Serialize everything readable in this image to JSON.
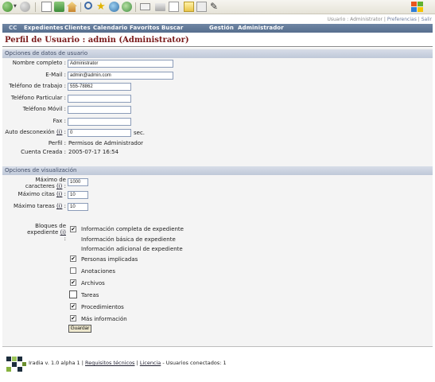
{
  "colors": {
    "nav_bar": "#6178a0",
    "title": "#7a1a1a",
    "section_header": "#c8d0de",
    "panel": "#f4f4f4",
    "button": "#efe9cf"
  },
  "toolbar": {
    "icons": [
      "back-icon",
      "forward-icon",
      "print-icon",
      "refresh-icon",
      "home-icon",
      "search-icon",
      "favorites-icon",
      "media-icon",
      "history-icon",
      "mail-icon",
      "print-icon",
      "edit-icon",
      "folder-icon",
      "messenger-icon",
      "research-icon",
      "windows-logo-icon"
    ]
  },
  "header": {
    "user_text": "Usuario : Administrator",
    "separator": "|",
    "preferences_link": "Preferencias",
    "exit_link": "Salir"
  },
  "nav": {
    "cc": "CC",
    "items": [
      "Expedientes",
      "Clientes",
      "Calendario",
      "Favoritos",
      "Buscar",
      "Gestión",
      "Administrador"
    ]
  },
  "page_title": "Perfil de Usuario : admin (Administrator)",
  "section1": {
    "header": "Opciones de datos de usuario",
    "fields": {
      "full_name": {
        "label": "Nombre completo :",
        "value": "Administrator"
      },
      "email": {
        "label": "E-Mail :",
        "value": "admin@admin.com"
      },
      "work_phone": {
        "label": "Teléfono de trabajo :",
        "value": "555-78862"
      },
      "home_phone": {
        "label": "Teléfono Particular :",
        "value": ""
      },
      "mobile_phone": {
        "label": "Teléfono Móvil :",
        "value": ""
      },
      "fax": {
        "label": "Fax :",
        "value": ""
      },
      "auto_logout": {
        "label": "Auto desconexión",
        "help": "(i)",
        "colon": ":",
        "value": "0",
        "unit": "sec."
      },
      "profile": {
        "label": "Perfil :",
        "value": "Permisos de Administrador"
      },
      "account_created": {
        "label": "Cuenta Creada :",
        "value": "2005-07-17 16:54"
      }
    }
  },
  "section2": {
    "header": "Opciones de visualización",
    "max_chars": {
      "label": "Máximo de caracteres",
      "help": "(i)",
      "colon": ":",
      "value": "1000"
    },
    "max_appointments": {
      "label": "Máximo citas",
      "help": "(i)",
      "colon": ":",
      "value": "10"
    },
    "max_tasks": {
      "label": "Máximo tareas",
      "help": "(i)",
      "colon": ":",
      "value": "10"
    },
    "blocks_label": "Bloques de expediente",
    "blocks_help": "(i)",
    "blocks_colon": ":",
    "blocks": [
      {
        "label": "Información completa de expediente",
        "checked": true,
        "check_mark": "✔"
      },
      {
        "label": "Información básica de expediente"
      },
      {
        "label": "Información adicional de expediente"
      },
      {
        "label": "Personas implicadas",
        "checked": true,
        "check_mark": "✔"
      },
      {
        "label": "Anotaciones",
        "checked": false,
        "check_mark": ""
      },
      {
        "label": "Archivos",
        "checked": true,
        "check_mark": "✔"
      },
      {
        "label": "Tareas",
        "checked": false,
        "check_mark": ""
      },
      {
        "label": "Procedimientos",
        "checked": true,
        "check_mark": "✔"
      },
      {
        "label": "Más información",
        "checked": true,
        "check_mark": "✔"
      }
    ],
    "save_label": "Guardar"
  },
  "footer": {
    "app_text": "Iradia v. 1.0 alpha 1",
    "sep1": "|",
    "link1": "Requisitos técnicos",
    "sep2": "|",
    "link2": "Licencia",
    "users_text": "- Usuarios conectados: 1"
  }
}
